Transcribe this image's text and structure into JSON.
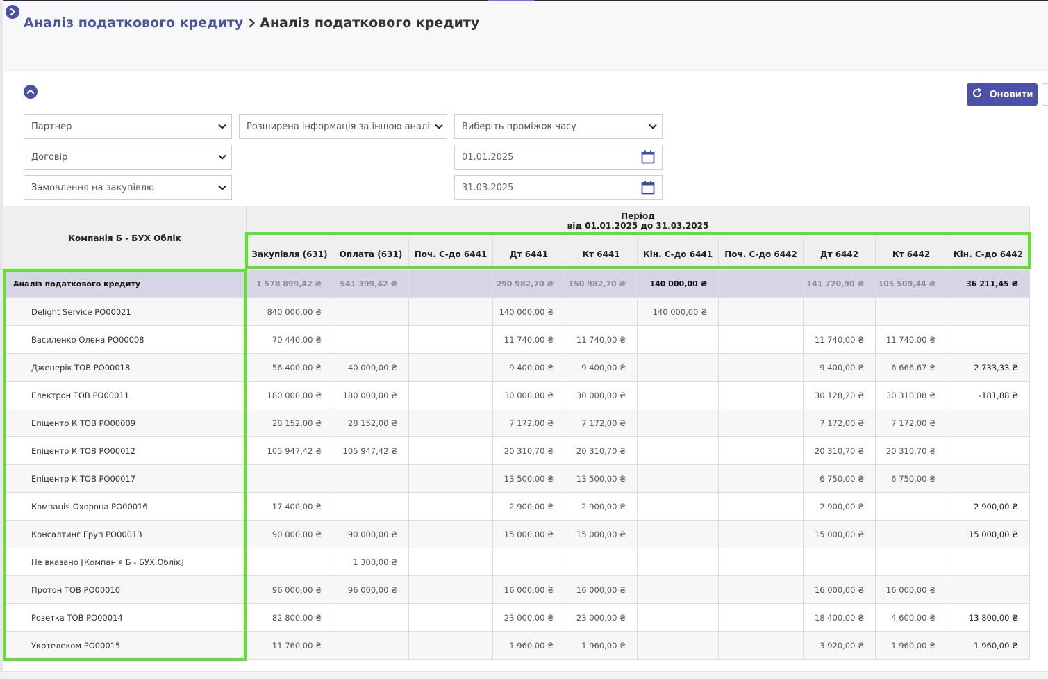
{
  "breadcrumb": {
    "parent": "Аналіз податкового кредиту",
    "current": "Аналіз податкового кредиту"
  },
  "toolbar": {
    "refresh_label": "Оновити"
  },
  "filters": {
    "partner": "Партнер",
    "contract": "Договір",
    "order": "Замовлення на закупівлю",
    "extended": "Розширена інформація за іншою аналітико",
    "period_select": "Виберіть проміжок часу",
    "date_from": "01.01.2025",
    "date_to": "31.03.2025"
  },
  "colors": {
    "accent": "#4a51a8",
    "highlight": "#5ce62a",
    "total_row": "#d5d5e5"
  },
  "table": {
    "corner": "Компанія Б - БУХ Облік",
    "period_title": "Період",
    "period_range": "від 01.01.2025 до 31.03.2025",
    "columns": [
      "Закупівля (631)",
      "Оплата (631)",
      "Поч. С-до 6441",
      "Дт 6441",
      "Кт 6441",
      "Кін. С-до 6441",
      "Поч. С-до 6442",
      "Дт 6442",
      "Кт 6442",
      "Кін. С-до 6442"
    ],
    "total": {
      "name": "Аналіз податкового кредиту",
      "values": [
        "1 578 899,42 ₴",
        "541 399,42 ₴",
        "",
        "290 982,70 ₴",
        "150 982,70 ₴",
        "140 000,00 ₴",
        "",
        "141 720,90 ₴",
        "105 509,44 ₴",
        "36 211,45 ₴"
      ]
    },
    "rows": [
      {
        "name": "Delight Service PO00021",
        "values": [
          "840 000,00 ₴",
          "",
          "",
          "140 000,00 ₴",
          "",
          "140 000,00 ₴",
          "",
          "",
          "",
          ""
        ]
      },
      {
        "name": "Василенко Олена PO00008",
        "values": [
          "70 440,00 ₴",
          "",
          "",
          "11 740,00 ₴",
          "11 740,00 ₴",
          "",
          "",
          "11 740,00 ₴",
          "11 740,00 ₴",
          ""
        ]
      },
      {
        "name": "Дженерік ТОВ PO00018",
        "values": [
          "56 400,00 ₴",
          "40 000,00 ₴",
          "",
          "9 400,00 ₴",
          "9 400,00 ₴",
          "",
          "",
          "9 400,00 ₴",
          "6 666,67 ₴",
          "2 733,33 ₴"
        ]
      },
      {
        "name": "Електрон ТОВ PO00011",
        "values": [
          "180 000,00 ₴",
          "180 000,00 ₴",
          "",
          "30 000,00 ₴",
          "30 000,00 ₴",
          "",
          "",
          "30 128,20 ₴",
          "30 310,08 ₴",
          "-181,88 ₴"
        ]
      },
      {
        "name": "Епіцентр К ТОВ PO00009",
        "values": [
          "28 152,00 ₴",
          "28 152,00 ₴",
          "",
          "7 172,00 ₴",
          "7 172,00 ₴",
          "",
          "",
          "7 172,00 ₴",
          "7 172,00 ₴",
          ""
        ]
      },
      {
        "name": "Епіцентр К ТОВ PO00012",
        "values": [
          "105 947,42 ₴",
          "105 947,42 ₴",
          "",
          "20 310,70 ₴",
          "20 310,70 ₴",
          "",
          "",
          "20 310,70 ₴",
          "20 310,70 ₴",
          ""
        ]
      },
      {
        "name": "Епіцентр К ТОВ PO00017",
        "values": [
          "",
          "",
          "",
          "13 500,00 ₴",
          "13 500,00 ₴",
          "",
          "",
          "6 750,00 ₴",
          "6 750,00 ₴",
          ""
        ]
      },
      {
        "name": "Компанія Охорона PO00016",
        "values": [
          "17 400,00 ₴",
          "",
          "",
          "2 900,00 ₴",
          "2 900,00 ₴",
          "",
          "",
          "2 900,00 ₴",
          "",
          "2 900,00 ₴"
        ]
      },
      {
        "name": "Консалтинг Груп PO00013",
        "values": [
          "90 000,00 ₴",
          "90 000,00 ₴",
          "",
          "15 000,00 ₴",
          "15 000,00 ₴",
          "",
          "",
          "15 000,00 ₴",
          "",
          "15 000,00 ₴"
        ]
      },
      {
        "name": "Не вказано [Компанія Б - БУХ Облік]",
        "values": [
          "",
          "1 300,00 ₴",
          "",
          "",
          "",
          "",
          "",
          "",
          "",
          ""
        ]
      },
      {
        "name": "Протон ТОВ PO00010",
        "values": [
          "96 000,00 ₴",
          "96 000,00 ₴",
          "",
          "16 000,00 ₴",
          "16 000,00 ₴",
          "",
          "",
          "16 000,00 ₴",
          "16 000,00 ₴",
          ""
        ]
      },
      {
        "name": "Розетка ТОВ PO00014",
        "values": [
          "82 800,00 ₴",
          "",
          "",
          "23 000,00 ₴",
          "23 000,00 ₴",
          "",
          "",
          "18 400,00 ₴",
          "4 600,00 ₴",
          "13 800,00 ₴"
        ]
      },
      {
        "name": "Укртелеком PO00015",
        "values": [
          "11 760,00 ₴",
          "",
          "",
          "1 960,00 ₴",
          "1 960,00 ₴",
          "",
          "",
          "3 920,00 ₴",
          "1 960,00 ₴",
          "1 960,00 ₴"
        ]
      }
    ]
  }
}
